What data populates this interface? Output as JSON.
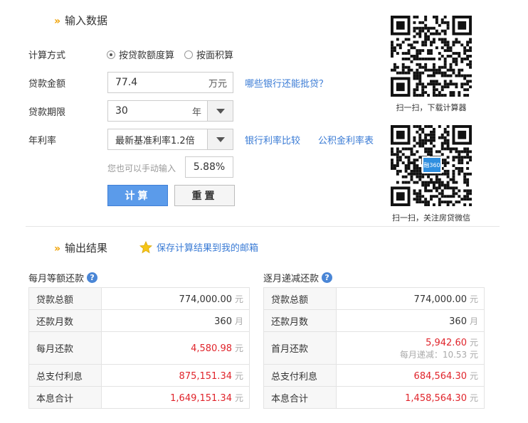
{
  "input_section": {
    "title": "输入数据",
    "calc_method_label": "计算方式",
    "calc_options": [
      "按贷款额度算",
      "按面积算"
    ],
    "calc_selected_index": 0,
    "loan_amount_label": "贷款金额",
    "loan_amount_value": "77.4",
    "loan_amount_unit": "万元",
    "loan_amount_link": "哪些银行还能批贷？",
    "loan_term_label": "贷款期限",
    "loan_term_value": "30",
    "loan_term_unit": "年",
    "rate_label": "年利率",
    "rate_select_value": "最新基准利率1.2倍",
    "rate_link_bank": "银行利率比较",
    "rate_link_fund": "公积金利率表",
    "manual_hint": "您也可以手动输入",
    "manual_rate_value": "5.88%",
    "calc_button": "计算",
    "reset_button": "重置"
  },
  "qr_codes": {
    "download_caption": "扫一扫，下载计算器",
    "wechat_caption": "扫一扫，关注房贷微信",
    "wechat_badge": "融360"
  },
  "output_section": {
    "title": "输出结果",
    "save_link": "保存计算结果到我的邮箱"
  },
  "equal_payment": {
    "title": "每月等额还款",
    "rows": [
      {
        "label": "贷款总额",
        "value": "774,000.00",
        "unit": "元",
        "red": false
      },
      {
        "label": "还款月数",
        "value": "360",
        "unit": "月",
        "red": false
      },
      {
        "label": "每月还款",
        "value": "4,580.98",
        "unit": "元",
        "red": true
      },
      {
        "label": "总支付利息",
        "value": "875,151.34",
        "unit": "元",
        "red": true
      },
      {
        "label": "本息合计",
        "value": "1,649,151.34",
        "unit": "元",
        "red": true
      }
    ]
  },
  "decreasing_payment": {
    "title": "逐月递减还款",
    "rows": [
      {
        "label": "贷款总额",
        "value": "774,000.00",
        "unit": "元",
        "red": false
      },
      {
        "label": "还款月数",
        "value": "360",
        "unit": "月",
        "red": false
      },
      {
        "label": "首月还款",
        "value": "5,942.60",
        "unit": "元",
        "red": true,
        "sub": "每月递减：10.53 元"
      },
      {
        "label": "总支付利息",
        "value": "684,564.30",
        "unit": "元",
        "red": true
      },
      {
        "label": "本息合计",
        "value": "1,458,564.30",
        "unit": "元",
        "red": true
      }
    ]
  },
  "colors": {
    "accent_blue": "#3a7bd5",
    "red_value": "#e0242b",
    "chevron": "#f0a000"
  }
}
